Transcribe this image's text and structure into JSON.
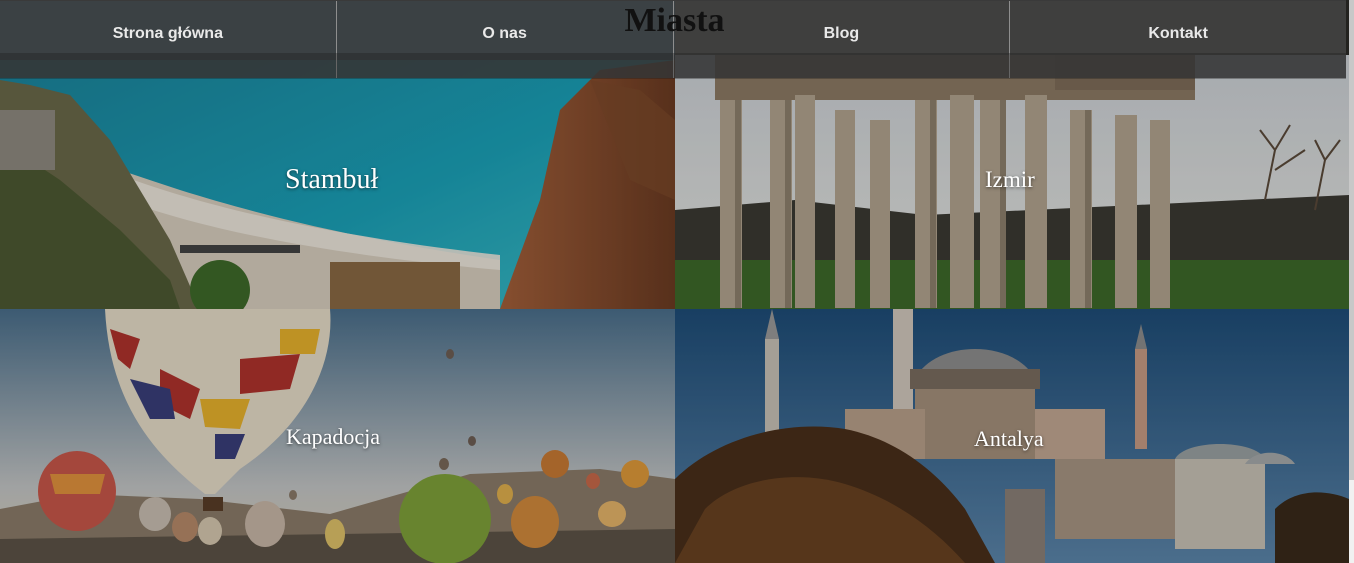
{
  "site": {
    "title": "Miasta"
  },
  "nav": {
    "items": [
      {
        "label": "Strona główna"
      },
      {
        "label": "O nas"
      },
      {
        "label": "Blog"
      },
      {
        "label": "Kontakt"
      }
    ]
  },
  "cities": [
    {
      "label": "Stambuł",
      "image": "beach-coast-photo"
    },
    {
      "label": "Izmir",
      "image": "ancient-columns-photo"
    },
    {
      "label": "Kapadocja",
      "image": "hot-air-balloons-photo"
    },
    {
      "label": "Antalya",
      "image": "mosque-domes-photo"
    }
  ],
  "colors": {
    "nav_background": "#464646",
    "nav_text": "#e9e9e9",
    "title_text": "#111111",
    "city_label": "#ffffff"
  }
}
